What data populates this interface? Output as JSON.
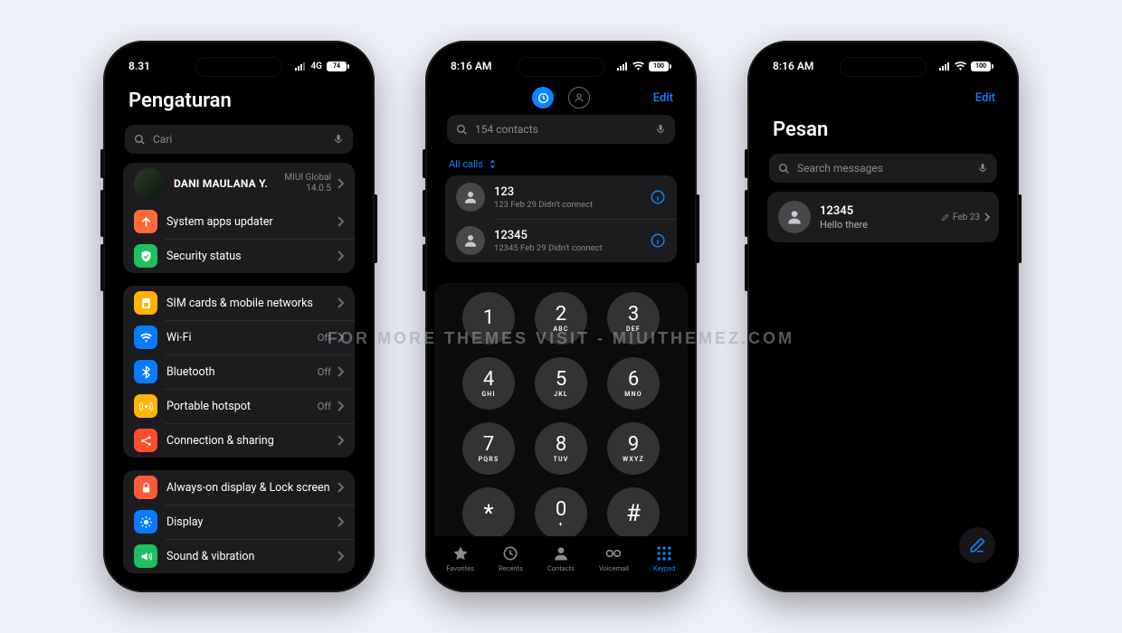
{
  "watermark": "FOR MORE THEMES VISIT - MIUITHEMEZ.COM",
  "settings": {
    "status": {
      "time": "8.31",
      "net": "4G",
      "battery": "74"
    },
    "title": "Pengaturan",
    "search_placeholder": "Cari",
    "profile": {
      "name": "DANI MAULANA Y.",
      "miui_label": "MIUI Global",
      "miui_version": "14.0.5"
    },
    "group_a": [
      {
        "label": "System apps updater",
        "icon": "arrow-up",
        "color": "#ff6a3d"
      },
      {
        "label": "Security status",
        "icon": "shield-check",
        "color": "#1dbf5e"
      }
    ],
    "group_b": [
      {
        "label": "SIM cards & mobile networks",
        "value": "",
        "icon": "sim",
        "color": "#ffb400"
      },
      {
        "label": "Wi-Fi",
        "value": "Off",
        "icon": "wifi",
        "color": "#0a7aff"
      },
      {
        "label": "Bluetooth",
        "value": "Off",
        "icon": "bluetooth",
        "color": "#0a7aff"
      },
      {
        "label": "Portable hotspot",
        "value": "Off",
        "icon": "hotspot",
        "color": "#ffb400"
      },
      {
        "label": "Connection & sharing",
        "value": "",
        "icon": "sharing",
        "color": "#ff4d2e"
      }
    ],
    "group_c": [
      {
        "label": "Always-on display & Lock screen",
        "icon": "lock",
        "color": "#ff5a3c"
      },
      {
        "label": "Display",
        "icon": "sun",
        "color": "#0a7aff"
      },
      {
        "label": "Sound & vibration",
        "icon": "speaker",
        "color": "#1dbf5e"
      }
    ]
  },
  "phone": {
    "status": {
      "time": "8:16 AM",
      "battery": "100"
    },
    "edit": "Edit",
    "search_placeholder": "154 contacts",
    "filter": "All calls",
    "calls": [
      {
        "name": "123",
        "detail": "123  Feb 29 Didn't connect"
      },
      {
        "name": "12345",
        "detail": "12345  Feb 29 Didn't connect"
      }
    ],
    "keys": [
      {
        "n": "1",
        "l": ""
      },
      {
        "n": "2",
        "l": "ABC"
      },
      {
        "n": "3",
        "l": "DEF"
      },
      {
        "n": "4",
        "l": "GHI"
      },
      {
        "n": "5",
        "l": "JKL"
      },
      {
        "n": "6",
        "l": "MNO"
      },
      {
        "n": "7",
        "l": "PQRS"
      },
      {
        "n": "8",
        "l": "TUV"
      },
      {
        "n": "9",
        "l": "WXYZ"
      },
      {
        "n": "*",
        "l": ""
      },
      {
        "n": "0",
        "l": "+"
      },
      {
        "n": "#",
        "l": ""
      }
    ],
    "tabs": [
      {
        "label": "Favorites"
      },
      {
        "label": "Recents"
      },
      {
        "label": "Contacts"
      },
      {
        "label": "Voicemail"
      },
      {
        "label": "Keypad"
      }
    ]
  },
  "messages": {
    "status": {
      "time": "8:16 AM",
      "battery": "100"
    },
    "edit": "Edit",
    "title": "Pesan",
    "search_placeholder": "Search messages",
    "threads": [
      {
        "name": "12345",
        "preview": "Hello there",
        "date": "Feb 23"
      }
    ]
  }
}
